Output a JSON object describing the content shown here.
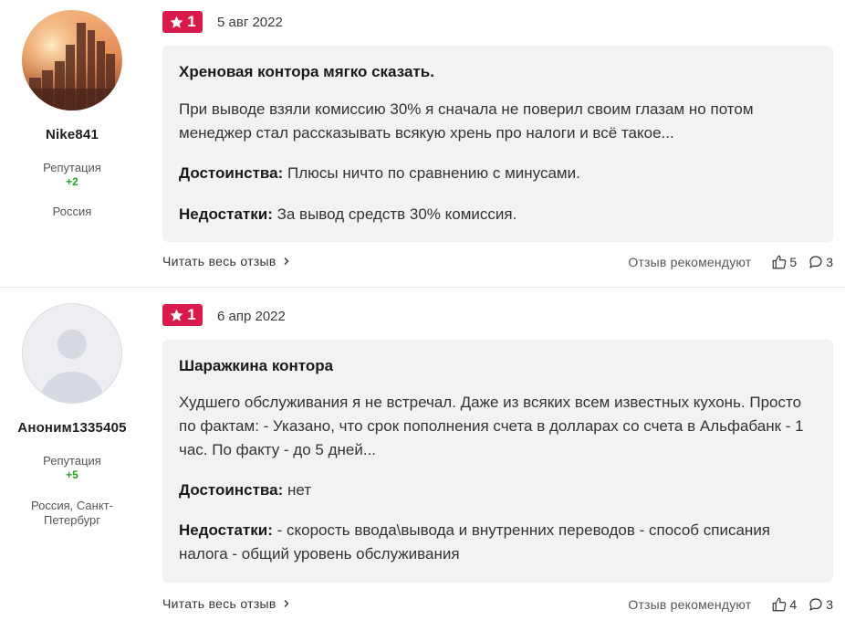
{
  "reviews": [
    {
      "user": {
        "name": "Nike841",
        "reputation_label": "Репутация",
        "reputation": "+2",
        "location": "Россия"
      },
      "rating": "1",
      "date": "5 авг 2022",
      "title": "Хреновая контора мягко сказать.",
      "body": "При выводе взяли комиссию 30% я сначала не поверил своим глазам но потом менеджер стал рассказывать всякую хрень про налоги и всё такое...",
      "pros_label": "Достоинства:",
      "pros": "Плюсы ничто по сравнению с минусами.",
      "cons_label": "Недостатки:",
      "cons": "За вывод средств 30% комиссия.",
      "read_more": "Читать весь отзыв",
      "recommend_label": "Отзыв рекомендуют",
      "likes": "5",
      "comments": "3"
    },
    {
      "user": {
        "name": "Аноним1335405",
        "reputation_label": "Репутация",
        "reputation": "+5",
        "location": "Россия, Санкт-Петербург"
      },
      "rating": "1",
      "date": "6 апр 2022",
      "title": "Шаражкина контора",
      "body": "Худшего обслуживания я не встречал. Даже из всяких всем известных кухонь. Просто по фактам: - Указано, что срок пополнения счета в долларах со счета в Альфабанк - 1 час. По факту - до 5 дней...",
      "pros_label": "Достоинства:",
      "pros": "нет",
      "cons_label": "Недостатки:",
      "cons": "- скорость ввода\\вывода и внутренних переводов - способ списания налога - общий уровень обслуживания",
      "read_more": "Читать весь отзыв",
      "recommend_label": "Отзыв рекомендуют",
      "likes": "4",
      "comments": "3"
    }
  ],
  "colors": {
    "badge": "#d81b4a",
    "reputation": "#2ba12b",
    "card_bg": "#f1f2f4"
  },
  "icons": {
    "rating": "star-icon",
    "read_more": "chevron-right-icon",
    "likes": "thumbs-up-icon",
    "comments": "comment-icon"
  }
}
